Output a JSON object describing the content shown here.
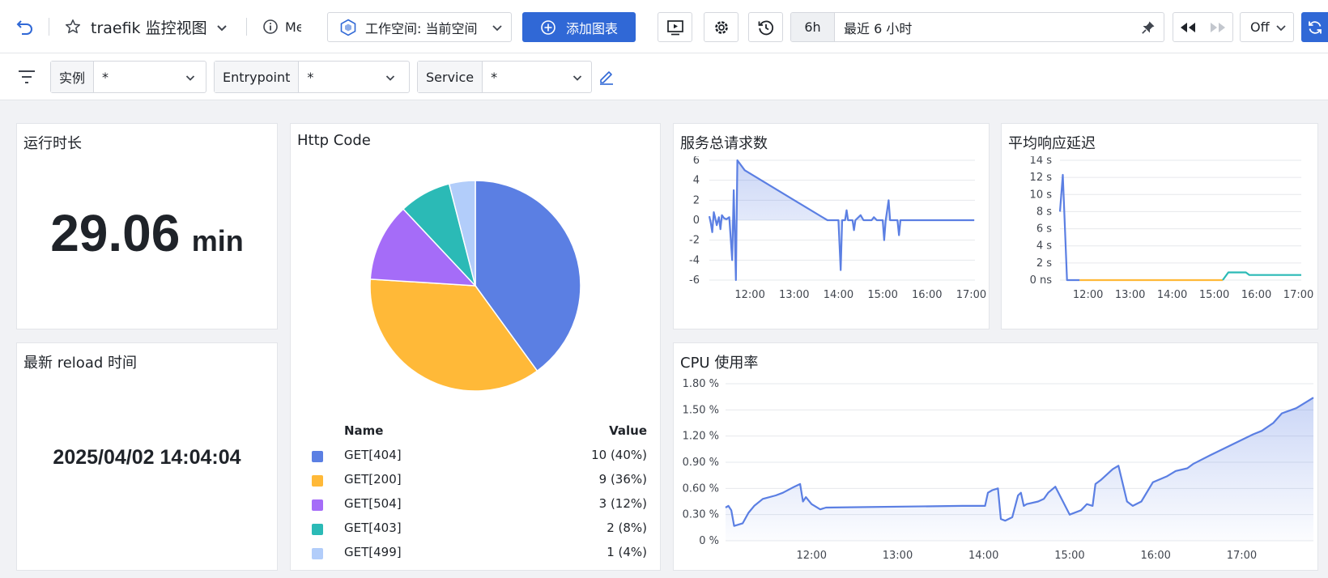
{
  "toolbar": {
    "dashboard_title": "traefik 监控视图",
    "meta_label": "Me",
    "workspace_label": "工作空间: 当前空间",
    "add_chart_label": "添加图表",
    "time_shortcut": "6h",
    "time_range_label": "最近 6 小时",
    "refresh_off_label": "Off"
  },
  "variables": [
    {
      "label": "实例",
      "value": "*"
    },
    {
      "label": "Entrypoint",
      "value": "*"
    },
    {
      "label": "Service",
      "value": "*"
    }
  ],
  "panels": {
    "uptime": {
      "title": "运行时长",
      "value": "29.06",
      "unit": "min"
    },
    "reload": {
      "title": "最新 reload 时间",
      "value": "2025/04/02 14:04:04"
    },
    "http_code": {
      "title": "Http Code",
      "legend_name_header": "Name",
      "legend_value_header": "Value"
    },
    "requests": {
      "title": "服务总请求数"
    },
    "latency": {
      "title": "平均响应延迟"
    },
    "cpu": {
      "title": "CPU 使用率"
    }
  },
  "colors": {
    "accent": "#3068d6",
    "blue": "#5b7fe3",
    "orange": "#ffb938",
    "purple": "#a56cf8",
    "teal": "#2bbab6",
    "light_blue": "#b2cdfa"
  },
  "chart_data": [
    {
      "type": "pie",
      "title": "Http Code",
      "slices": [
        {
          "name": "GET[404]",
          "value": 10,
          "label": "10 (40%)",
          "color": "#5b7fe3"
        },
        {
          "name": "GET[200]",
          "value": 9,
          "label": "9 (36%)",
          "color": "#ffb938"
        },
        {
          "name": "GET[504]",
          "value": 3,
          "label": "3 (12%)",
          "color": "#a56cf8"
        },
        {
          "name": "GET[403]",
          "value": 2,
          "label": "2 (8%)",
          "color": "#2bbab6"
        },
        {
          "name": "GET[499]",
          "value": 1,
          "label": "1 (4%)",
          "color": "#b2cdfa"
        }
      ]
    },
    {
      "type": "line",
      "title": "服务总请求数",
      "x_ticks": [
        "12:00",
        "13:00",
        "14:00",
        "15:00",
        "16:00",
        "17:00"
      ],
      "y_ticks": [
        "6",
        "4",
        "2",
        "0",
        "-2",
        "-4",
        "-6"
      ],
      "ylim": [
        -6,
        6
      ],
      "series": [
        {
          "color": "#5b7fe3",
          "points": [
            [
              "11:05",
              0.4
            ],
            [
              "11:07",
              -0.3
            ],
            [
              "11:09",
              -1.2
            ],
            [
              "11:11",
              0.8
            ],
            [
              "11:13",
              0.2
            ],
            [
              "11:15",
              -0.5
            ],
            [
              "11:18",
              0.3
            ],
            [
              "11:20",
              -0.9
            ],
            [
              "11:22",
              0.5
            ],
            [
              "11:25",
              0.2
            ],
            [
              "11:28",
              0.1
            ],
            [
              "11:32",
              0.3
            ],
            [
              "11:36",
              -4.0
            ],
            [
              "11:38",
              3.0
            ],
            [
              "11:41",
              -6.0
            ],
            [
              "11:43",
              6.0
            ],
            [
              "11:53",
              5.0
            ],
            [
              "13:00",
              2.0
            ],
            [
              "13:45",
              0.0
            ],
            [
              "14:00",
              0.0
            ],
            [
              "14:03",
              -5.0
            ],
            [
              "14:05",
              0.0
            ],
            [
              "14:09",
              0.0
            ],
            [
              "14:11",
              1.0
            ],
            [
              "14:13",
              0.0
            ],
            [
              "14:19",
              0.0
            ],
            [
              "14:21",
              -1.0
            ],
            [
              "14:23",
              0.0
            ],
            [
              "14:30",
              0.5
            ],
            [
              "14:34",
              0.0
            ],
            [
              "14:45",
              0.0
            ],
            [
              "14:48",
              0.3
            ],
            [
              "14:52",
              0.0
            ],
            [
              "15:00",
              0.0
            ],
            [
              "15:02",
              -2.0
            ],
            [
              "15:04",
              0.0
            ],
            [
              "15:08",
              2.0
            ],
            [
              "15:10",
              0.0
            ],
            [
              "15:20",
              0.0
            ],
            [
              "15:22",
              -1.5
            ],
            [
              "15:24",
              0.0
            ],
            [
              "17:04",
              0.0
            ]
          ]
        }
      ]
    },
    {
      "type": "line",
      "title": "平均响应延迟",
      "x_ticks": [
        "12:00",
        "13:00",
        "14:00",
        "15:00",
        "16:00",
        "17:00"
      ],
      "y_ticks": [
        "14 s",
        "12 s",
        "10 s",
        "8 s",
        "6 s",
        "4 s",
        "2 s",
        "0 ns"
      ],
      "ylim": [
        0,
        14
      ],
      "series": [
        {
          "color": "#5b7fe3",
          "points": [
            [
              "11:20",
              8.0
            ],
            [
              "11:24",
              12.3
            ],
            [
              "11:30",
              0.0
            ],
            [
              "11:48",
              0.0
            ]
          ]
        },
        {
          "color": "#ffb938",
          "points": [
            [
              "11:48",
              0.0
            ],
            [
              "15:12",
              0.0
            ]
          ]
        },
        {
          "color": "#2bbab6",
          "points": [
            [
              "15:12",
              0.0
            ],
            [
              "15:20",
              0.9
            ],
            [
              "15:45",
              0.9
            ],
            [
              "15:50",
              0.6
            ],
            [
              "17:04",
              0.6
            ]
          ]
        }
      ]
    },
    {
      "type": "area",
      "title": "CPU 使用率",
      "x_ticks": [
        "12:00",
        "13:00",
        "14:00",
        "15:00",
        "16:00",
        "17:00"
      ],
      "y_ticks": [
        "1.80 %",
        "1.50 %",
        "1.20 %",
        "0.90 %",
        "0.60 %",
        "0.30 %",
        "0 %"
      ],
      "ylim": [
        0,
        1.8
      ],
      "series": [
        {
          "color": "#5b7fe3",
          "points": [
            [
              "11:00",
              0.38
            ],
            [
              "11:02",
              0.4
            ],
            [
              "11:04",
              0.35
            ],
            [
              "11:06",
              0.17
            ],
            [
              "11:12",
              0.2
            ],
            [
              "11:16",
              0.32
            ],
            [
              "11:20",
              0.4
            ],
            [
              "11:26",
              0.48
            ],
            [
              "11:35",
              0.52
            ],
            [
              "11:40",
              0.55
            ],
            [
              "11:48",
              0.62
            ],
            [
              "11:52",
              0.65
            ],
            [
              "11:54",
              0.45
            ],
            [
              "11:56",
              0.5
            ],
            [
              "12:00",
              0.42
            ],
            [
              "12:06",
              0.36
            ],
            [
              "12:10",
              0.38
            ],
            [
              "13:45",
              0.4
            ],
            [
              "14:01",
              0.4
            ],
            [
              "14:03",
              0.55
            ],
            [
              "14:06",
              0.58
            ],
            [
              "14:10",
              0.6
            ],
            [
              "14:12",
              0.25
            ],
            [
              "14:15",
              0.23
            ],
            [
              "14:20",
              0.27
            ],
            [
              "14:24",
              0.52
            ],
            [
              "14:26",
              0.55
            ],
            [
              "14:28",
              0.4
            ],
            [
              "14:30",
              0.42
            ],
            [
              "14:38",
              0.45
            ],
            [
              "14:42",
              0.48
            ],
            [
              "14:45",
              0.55
            ],
            [
              "14:50",
              0.62
            ],
            [
              "15:00",
              0.3
            ],
            [
              "15:08",
              0.35
            ],
            [
              "15:12",
              0.42
            ],
            [
              "15:16",
              0.4
            ],
            [
              "15:18",
              0.65
            ],
            [
              "15:22",
              0.7
            ],
            [
              "15:30",
              0.82
            ],
            [
              "15:34",
              0.86
            ],
            [
              "15:40",
              0.45
            ],
            [
              "15:44",
              0.4
            ],
            [
              "15:50",
              0.45
            ],
            [
              "15:58",
              0.67
            ],
            [
              "16:08",
              0.74
            ],
            [
              "16:14",
              0.8
            ],
            [
              "16:22",
              0.83
            ],
            [
              "16:26",
              0.88
            ],
            [
              "16:38",
              0.98
            ],
            [
              "16:48",
              1.06
            ],
            [
              "16:58",
              1.14
            ],
            [
              "17:08",
              1.22
            ],
            [
              "17:14",
              1.26
            ],
            [
              "17:22",
              1.35
            ],
            [
              "17:28",
              1.46
            ],
            [
              "17:38",
              1.52
            ],
            [
              "17:46",
              1.6
            ],
            [
              "17:50",
              1.64
            ]
          ]
        }
      ]
    }
  ]
}
